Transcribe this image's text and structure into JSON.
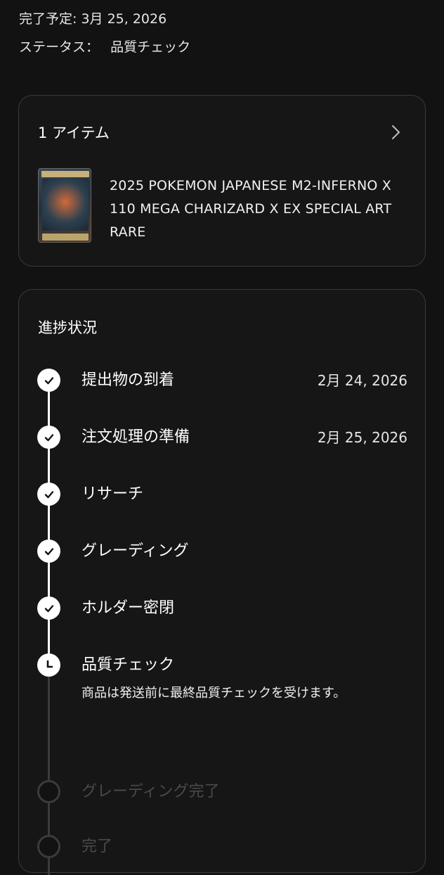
{
  "header": {
    "completion_label": "完了予定:",
    "completion_date": "3月 25, 2026",
    "status_label": "ステータス：",
    "status_value": "品質チェック"
  },
  "items_card": {
    "title": "1 アイテム",
    "item": {
      "title": "2025 POKEMON JAPANESE M2-INFERNO X 110 MEGA CHARIZARD X EX SPECIAL ART RARE"
    },
    "chevron_icon": "chevron-right-icon"
  },
  "progress": {
    "title": "進捗状況",
    "steps": [
      {
        "label": "提出物の到着",
        "date": "2月 24, 2026",
        "state": "done",
        "icon": "check-icon"
      },
      {
        "label": "注文処理の準備",
        "date": "2月 25, 2026",
        "state": "done",
        "icon": "check-icon"
      },
      {
        "label": "リサーチ",
        "date": "",
        "state": "done",
        "icon": "check-icon"
      },
      {
        "label": "グレーディング",
        "date": "",
        "state": "done",
        "icon": "check-icon"
      },
      {
        "label": "ホルダー密閉",
        "date": "",
        "state": "done",
        "icon": "check-icon"
      },
      {
        "label": "品質チェック",
        "date": "",
        "state": "current",
        "icon": "clock-icon",
        "description": "商品は発送前に最終品質チェックを受けます。"
      },
      {
        "label": "グレーディング完了",
        "date": "",
        "state": "pending",
        "icon": "empty-circle-icon"
      },
      {
        "label": "完了",
        "date": "",
        "state": "pending",
        "icon": "empty-circle-icon"
      }
    ]
  },
  "colors": {
    "background": "#121212",
    "card_border": "#3a3a3a",
    "done": "#ffffff",
    "pending": "#3b3b3b"
  }
}
